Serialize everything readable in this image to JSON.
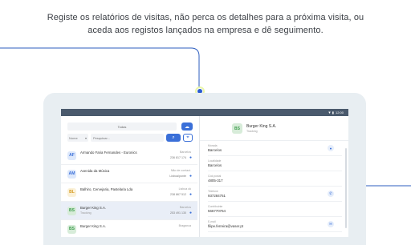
{
  "headline": {
    "line1": "Registe os relatórios de visitas, não perca os detalhes para a próxima visita, ou",
    "line2": "aceda aos registos lançados na empresa e dê seguimento."
  },
  "colors": {
    "accent": "#3a6fd8",
    "statusbar": "#4a5a6d",
    "connector": "#2c5dbf",
    "dot": "#d8ff3c"
  },
  "statusbar": {
    "wifi_icon": "wifi-icon",
    "battery_icon": "battery-icon",
    "time": "12:00"
  },
  "list_panel": {
    "tab_label": "Todas",
    "cloud_icon": "cloud-sync-icon",
    "filter_select": "Nome",
    "search_placeholder": "Pesquisar...",
    "search_icon": "search-icon",
    "location_icon": "pin-icon",
    "items": [
      {
        "initials": "AF",
        "name": "Armando Faria Fernandes - Euronics",
        "sub": "",
        "meta1": "Barcelos",
        "meta2": "236 817 174",
        "bg": "#dde8fb",
        "fg": "#3a6fd8"
      },
      {
        "initials": "AM",
        "name": "Avenida da Música",
        "sub": "",
        "meta1": "Não de contact.",
        "meta2": "Lisboa/ponte",
        "bg": "#dde8fb",
        "fg": "#3a6fd8"
      },
      {
        "initials": "BL",
        "name": "Balhiro, Cervejaria, Pastelaria Lda",
        "sub": "",
        "meta1": "Lisboa ok",
        "meta2": "238 867 512",
        "bg": "#fbf1d8",
        "fg": "#d59a1f"
      },
      {
        "initials": "BS",
        "name": "Burger King S.A.",
        "sub": "Tracking",
        "meta1": "Barcelos",
        "meta2": "253 491 130",
        "bg": "#d7ecd9",
        "fg": "#3c9d4b"
      },
      {
        "initials": "BS",
        "name": "Burger King S.A.",
        "sub": "",
        "meta1": "Braganca",
        "meta2": "",
        "bg": "#d7ecd9",
        "fg": "#3c9d4b"
      }
    ]
  },
  "detail_panel": {
    "initials": "BS",
    "title": "Burger King S.A.",
    "subtitle": "Tracking",
    "fields": [
      {
        "label": "Morada",
        "value": "Barcelos",
        "icon": "pin-icon"
      },
      {
        "label": "Localidade",
        "value": "Barcelos",
        "icon": ""
      },
      {
        "label": "Cód.postal",
        "value": "4805-317",
        "icon": ""
      },
      {
        "label": "Telefone",
        "value": "937284751",
        "icon": "phone-icon"
      },
      {
        "label": "Contribuinte",
        "value": "566770764",
        "icon": ""
      },
      {
        "label": "E-mail",
        "value": "filipe.ferreira@vaser.pt",
        "icon": "mail-icon"
      }
    ]
  }
}
